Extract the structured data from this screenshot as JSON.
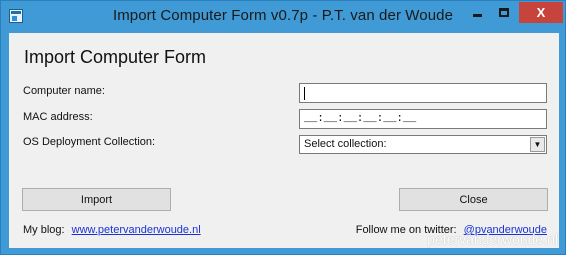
{
  "window": {
    "title": "Import Computer Form v0.7p - P.T. van der Woude",
    "close_glyph": "X"
  },
  "form": {
    "heading": "Import Computer Form",
    "computer_name_label": "Computer name:",
    "computer_name_value": "",
    "mac_label": "MAC address:",
    "mac_value": "__:__:__:__:__:__",
    "os_label": "OS Deployment Collection:",
    "os_selected": "Select collection:",
    "import_label": "Import",
    "close_label": "Close"
  },
  "footer": {
    "blog_label": "My blog:",
    "blog_link": "www.petervanderwoude.nl",
    "twitter_label": "Follow me on twitter:",
    "twitter_link": "@pvanderwoude"
  },
  "watermark": "petervanderwoude.nl",
  "colors": {
    "titlebar": "#3f9ad6",
    "close_button": "#c7443d",
    "client_bg": "#f0f0f0",
    "link": "#1a33d6"
  }
}
